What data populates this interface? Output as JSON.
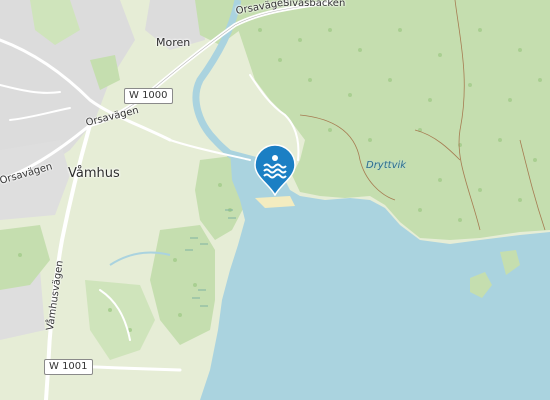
{
  "map": {
    "places": {
      "vamhus": "Våmhus",
      "moren": "Moren",
      "dryttvik": "Dryttvik"
    },
    "roads": {
      "orsavagen_east": "Orsavägen",
      "orsavagen_mid": "Orsavägen",
      "orsavagen_west": "Orsavägen",
      "sivasbacken": "Sivasbacken",
      "vamhusvagen": "Våmhusvägen"
    },
    "road_shields": {
      "w1000": "W 1000",
      "w1001": "W 1001"
    },
    "marker": {
      "icon": "swimming-icon",
      "color": "#1b7fc4"
    },
    "colors": {
      "water": "#aad3df",
      "forest": "#c8e0b3",
      "meadow": "#e3ecd1",
      "residential": "#dcdcdc",
      "road": "#ffffff"
    }
  }
}
